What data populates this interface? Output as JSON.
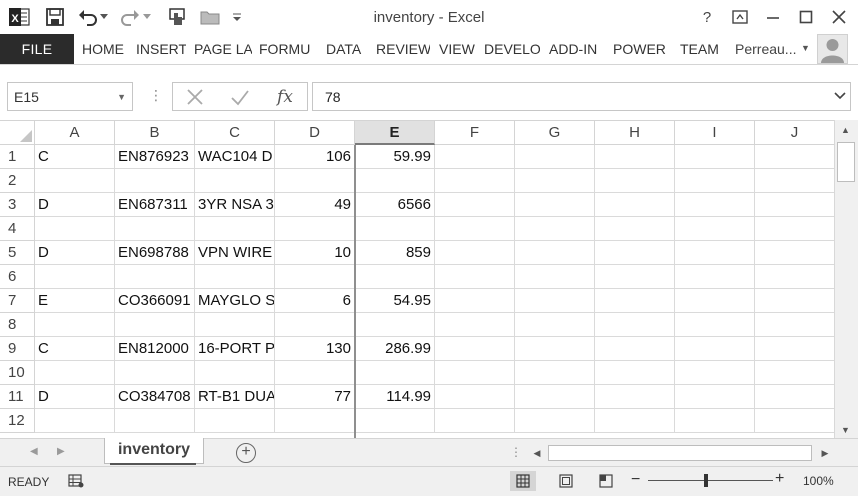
{
  "window": {
    "title": "inventory - Excel",
    "help": "?"
  },
  "ribbon": {
    "file_tab": "FILE",
    "tabs": [
      "HOME",
      "INSERT",
      "PAGE LA",
      "FORMU",
      "DATA",
      "REVIEW",
      "VIEW",
      "DEVELO",
      "ADD-IN",
      "POWER",
      "TEAM"
    ],
    "user": "Perreau..."
  },
  "formula_bar": {
    "name_box": "E15",
    "formula": "78",
    "fx_label": "fx"
  },
  "grid": {
    "columns": [
      "A",
      "B",
      "C",
      "D",
      "E",
      "F",
      "G",
      "H",
      "I",
      "J"
    ],
    "active_column": "E",
    "rows": [
      {
        "n": "1",
        "cells": [
          "C",
          "EN876923",
          "WAC104 D",
          "106",
          "59.99"
        ]
      },
      {
        "n": "2",
        "cells": [
          "",
          "",
          "",
          "",
          ""
        ]
      },
      {
        "n": "3",
        "cells": [
          "D",
          "EN687311",
          "3YR NSA 3",
          "49",
          "6566"
        ]
      },
      {
        "n": "4",
        "cells": [
          "",
          "",
          "",
          "",
          ""
        ]
      },
      {
        "n": "5",
        "cells": [
          "D",
          "EN698788",
          "VPN WIRE",
          "10",
          "859"
        ]
      },
      {
        "n": "6",
        "cells": [
          "",
          "",
          "",
          "",
          ""
        ]
      },
      {
        "n": "7",
        "cells": [
          "E",
          "CO366091",
          "MAYGLO S",
          "6",
          "54.95"
        ]
      },
      {
        "n": "8",
        "cells": [
          "",
          "",
          "",
          "",
          ""
        ]
      },
      {
        "n": "9",
        "cells": [
          "C",
          "EN812000",
          "16-PORT P",
          "130",
          "286.99"
        ]
      },
      {
        "n": "10",
        "cells": [
          "",
          "",
          "",
          "",
          ""
        ]
      },
      {
        "n": "11",
        "cells": [
          "D",
          "CO384708",
          "RT-B1 DUA",
          "77",
          "114.99"
        ]
      },
      {
        "n": "12",
        "cells": [
          "",
          "",
          "",
          "",
          ""
        ]
      }
    ]
  },
  "sheets": {
    "active": "inventory"
  },
  "status": {
    "mode": "READY",
    "zoom": "100%",
    "zoom_fraction": 0.46
  },
  "icons": {
    "app": "excel-logo-icon",
    "save": "save-icon",
    "undo": "undo-icon",
    "redo": "redo-icon",
    "touch": "touch-mode-icon",
    "open": "open-folder-icon",
    "customize": "customize-qat-icon"
  }
}
